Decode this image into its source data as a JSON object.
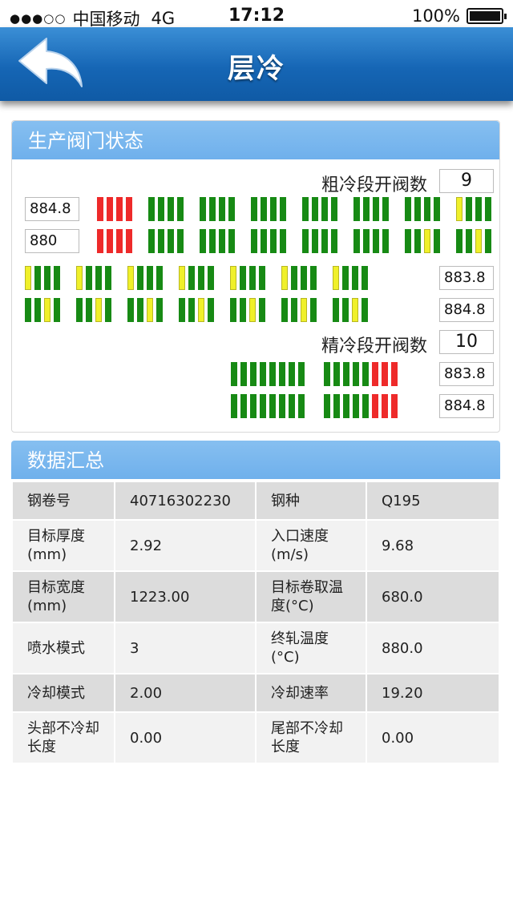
{
  "status_bar": {
    "signal": "●●●○○",
    "carrier": "中国移动",
    "network": "4G",
    "time": "17:12",
    "battery": "100%"
  },
  "nav": {
    "title": "层冷",
    "back_icon": "back-arrow-icon"
  },
  "valves": {
    "title": "生产阀门状态",
    "coarse_label": "粗冷段开阀数",
    "coarse_count": "9",
    "fine_label": "精冷段开阀数",
    "fine_count": "10",
    "row1_value": "884.8",
    "row2_value": "880",
    "row3_value": "883.8",
    "row4_value": "884.8",
    "row5_value": "883.8",
    "row6_value": "884.8",
    "colors": {
      "green": "#178a14",
      "red": "#ee2a2a",
      "yellow": "#f0f02a"
    }
  },
  "summary": {
    "title": "数据汇总",
    "rows": [
      [
        "钢卷号",
        "40716302230",
        "钢种",
        "Q195"
      ],
      [
        "目标厚度(mm)",
        "2.92",
        "入口速度(m/s)",
        "9.68"
      ],
      [
        "目标宽度(mm)",
        "1223.00",
        "目标卷取温度(°C)",
        "680.0"
      ],
      [
        "喷水模式",
        "3",
        "终轧温度(°C)",
        "880.0"
      ],
      [
        "冷却模式",
        "2.00",
        "冷却速率",
        "19.20"
      ],
      [
        "头部不冷却长度",
        "0.00",
        "尾部不冷却长度",
        "0.00"
      ]
    ]
  }
}
